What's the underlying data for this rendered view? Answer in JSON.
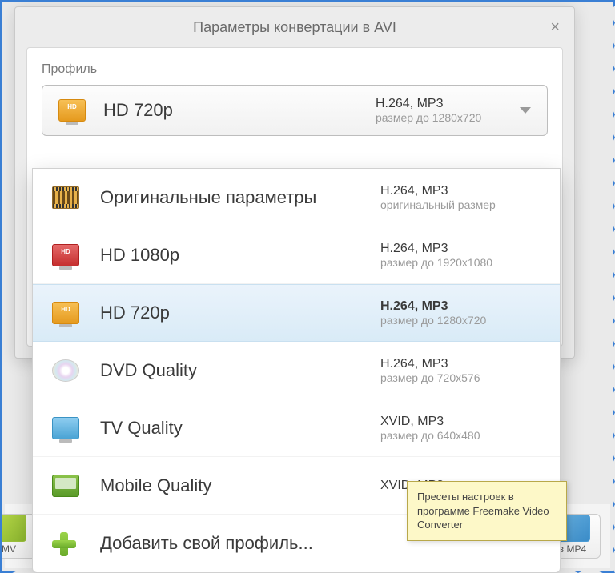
{
  "dialog": {
    "title": "Параметры конвертации в AVI",
    "profile_label": "Профиль"
  },
  "selected": {
    "name": "HD 720p",
    "codec": "H.264, MP3",
    "size": "размер до 1280x720",
    "icon": "monitor-orange"
  },
  "options": [
    {
      "name": "Оригинальные параметры",
      "codec": "H.264, MP3",
      "size": "оригинальный размер",
      "icon": "film",
      "highlight": false
    },
    {
      "name": "HD 1080p",
      "codec": "H.264, MP3",
      "size": "размер до 1920x1080",
      "icon": "monitor-red",
      "highlight": false
    },
    {
      "name": "HD 720p",
      "codec": "H.264, MP3",
      "size": "размер до 1280x720",
      "icon": "monitor-orange",
      "highlight": true
    },
    {
      "name": "DVD Quality",
      "codec": "H.264, MP3",
      "size": "размер до 720x576",
      "icon": "disc",
      "highlight": false
    },
    {
      "name": "TV Quality",
      "codec": "XVID, MP3",
      "size": "размер до 640x480",
      "icon": "monitor-blue",
      "highlight": false
    },
    {
      "name": "Mobile Quality",
      "codec": "XVID, MP3",
      "size": "",
      "icon": "phone",
      "highlight": false
    }
  ],
  "add_profile": "Добавить свой профиль...",
  "callout": "Пресеты настроек в программе Freemake Video Converter",
  "bg": {
    "left_label": "MV",
    "right_label": "в MP4"
  }
}
